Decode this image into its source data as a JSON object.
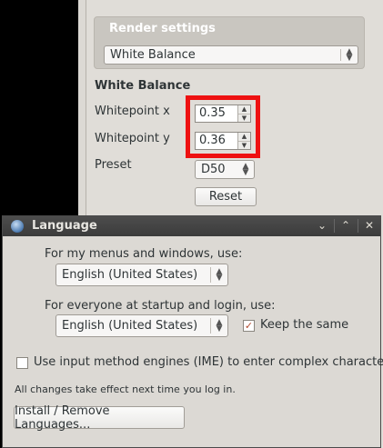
{
  "render_settings": {
    "group_title": "Render settings",
    "mode_select": "White Balance",
    "section_heading": "White Balance",
    "whitepoint_x_label": "Whitepoint x",
    "whitepoint_x_value": "0.35",
    "whitepoint_y_label": "Whitepoint y",
    "whitepoint_y_value": "0.36",
    "preset_label": "Preset",
    "preset_value": "D50",
    "reset_label": "Reset"
  },
  "language_dialog": {
    "title": "Language",
    "menus_label": "For my menus and windows, use:",
    "menus_language": "English (United States)",
    "startup_label": "For everyone at startup and login, use:",
    "startup_language": "English (United States)",
    "keep_same_label": "Keep the same",
    "keep_same_checked": true,
    "ime_label": "Use input method engines (IME) to enter complex characters",
    "ime_checked": false,
    "note": "All changes take effect next time you log in.",
    "install_button": "Install / Remove Languages..."
  },
  "colors": {
    "highlight": "#ee1111",
    "titlebar": "#3f3f3f",
    "background": "#dcd9d4"
  }
}
